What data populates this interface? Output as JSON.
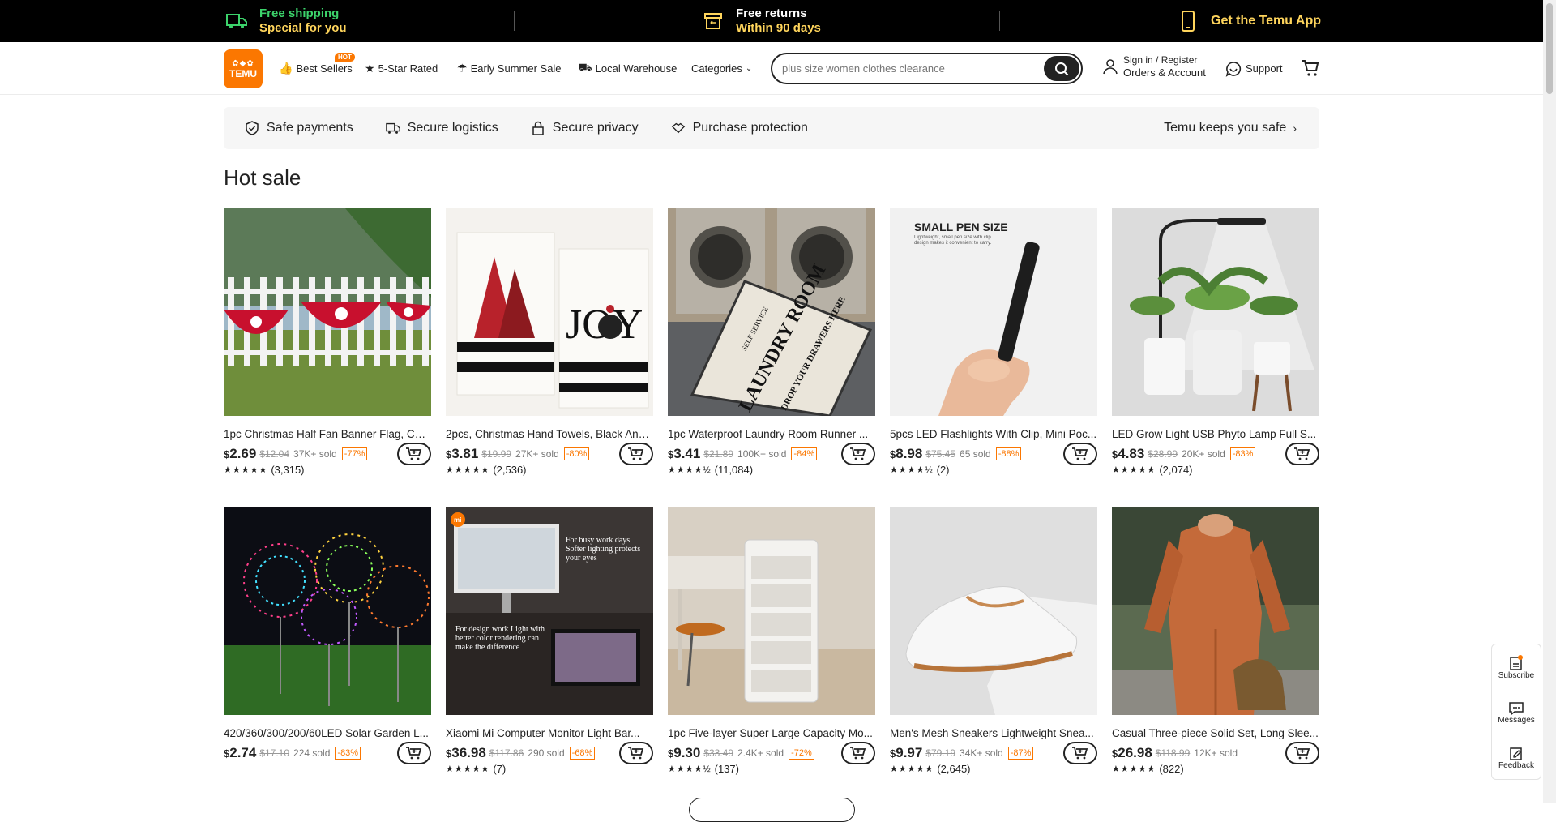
{
  "topbar": {
    "shipping_l1": "Free shipping",
    "shipping_l2": "Special for you",
    "returns_l1": "Free returns",
    "returns_l2": "Within 90 days",
    "app": "Get the Temu App"
  },
  "header": {
    "logo": "TEMU",
    "nav": [
      {
        "label": "Best Sellers",
        "icon": "thumbs-up-icon"
      },
      {
        "label": "5-Star Rated",
        "icon": "star-badge-icon"
      },
      {
        "label": "Early Summer Sale",
        "icon": "umbrella-icon"
      },
      {
        "label": "Local Warehouse",
        "icon": "truck-icon"
      },
      {
        "label": "Categories",
        "icon": "chevron-down-icon"
      }
    ],
    "hot_badge": "HOT",
    "search_placeholder": "plus size women clothes clearance",
    "signin": "Sign in / Register",
    "orders": "Orders & Account",
    "support": "Support"
  },
  "safe": {
    "items": [
      "Safe payments",
      "Secure logistics",
      "Secure privacy",
      "Purchase protection"
    ],
    "right": "Temu keeps you safe"
  },
  "section_title": "Hot sale",
  "products": [
    {
      "name": "1pc Christmas Half Fan Banner Flag, Chr...",
      "cur": "$",
      "price": "2.69",
      "orig": "$12.04",
      "sold": "37K+ sold",
      "disc": "-77%",
      "rating": 5,
      "reviews": "(3,315)"
    },
    {
      "name": "2pcs, Christmas Hand Towels, Black And...",
      "cur": "$",
      "price": "3.81",
      "orig": "$19.99",
      "sold": "27K+ sold",
      "disc": "-80%",
      "rating": 5,
      "reviews": "(2,536)"
    },
    {
      "name": "1pc Waterproof Laundry Room Runner ...",
      "cur": "$",
      "price": "3.41",
      "orig": "$21.89",
      "sold": "100K+ sold",
      "disc": "-84%",
      "rating": 4.5,
      "reviews": "(11,084)"
    },
    {
      "name": "5pcs LED Flashlights With Clip, Mini Poc...",
      "cur": "$",
      "price": "8.98",
      "orig": "$75.45",
      "sold": "65 sold",
      "disc": "-88%",
      "rating": 4.5,
      "reviews": "(2)"
    },
    {
      "name": "LED Grow Light USB Phyto Lamp Full S...",
      "cur": "$",
      "price": "4.83",
      "orig": "$28.99",
      "sold": "20K+ sold",
      "disc": "-83%",
      "rating": 5,
      "reviews": "(2,074)"
    },
    {
      "name": "420/360/300/200/60LED Solar Garden L...",
      "cur": "$",
      "price": "2.74",
      "orig": "$17.10",
      "sold": "224 sold",
      "disc": "-83%",
      "rating": 0,
      "reviews": ""
    },
    {
      "name": "Xiaomi Mi Computer Monitor Light Bar...",
      "cur": "$",
      "price": "36.98",
      "orig": "$117.86",
      "sold": "290 sold",
      "disc": "-68%",
      "rating": 5,
      "reviews": "(7)"
    },
    {
      "name": "1pc Five-layer Super Large Capacity Mo...",
      "cur": "$",
      "price": "9.30",
      "orig": "$33.49",
      "sold": "2.4K+ sold",
      "disc": "-72%",
      "rating": 4.5,
      "reviews": "(137)"
    },
    {
      "name": "Men's Mesh Sneakers Lightweight Snea...",
      "cur": "$",
      "price": "9.97",
      "orig": "$79.19",
      "sold": "34K+ sold",
      "disc": "-87%",
      "rating": 5,
      "reviews": "(2,645)"
    },
    {
      "name": "Casual Three-piece Solid Set, Long Slee...",
      "cur": "$",
      "price": "26.98",
      "orig": "$118.99",
      "sold": "12K+ sold",
      "disc": "",
      "rating": 5,
      "reviews": "(822)"
    }
  ],
  "image_texts": {
    "flashlight_title": "SMALL PEN SIZE",
    "flashlight_sub": "Lightweight, small pen size with clip design makes it convenient to carry.",
    "rug_main": "LAUNDRY ROOM",
    "rug_sub": "DROP YOUR DRAWERS HERE",
    "rug_top": "SELF SERVICE",
    "monitor_top": "For busy work days Softer lighting protects your eyes",
    "monitor_bottom": "For design work Light with better color rendering can make the difference",
    "mi_badge": "mi",
    "towel_joy": "JOY"
  },
  "side": {
    "subscribe": "Subscribe",
    "messages": "Messages",
    "feedback": "Feedback"
  },
  "colors": {
    "accent": "#fb7701",
    "topbar_yellow": "#ffd55c",
    "black": "#000000"
  }
}
